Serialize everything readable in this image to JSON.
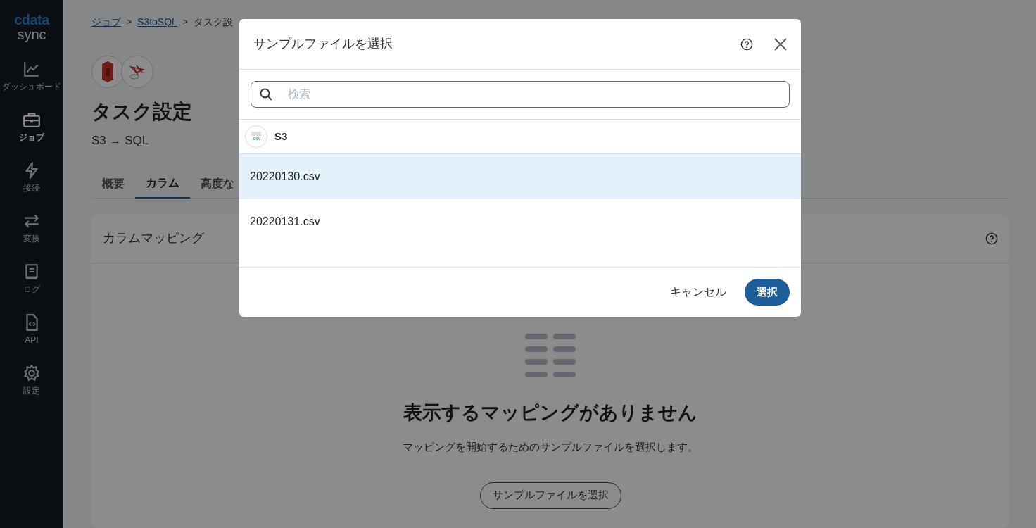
{
  "sidebar": {
    "logo": {
      "brand": "cdata",
      "product": "sync"
    },
    "items": [
      {
        "label": "ダッシュボード",
        "selected": false
      },
      {
        "label": "ジョブ",
        "selected": true
      },
      {
        "label": "接続",
        "selected": false
      },
      {
        "label": "変換",
        "selected": false
      },
      {
        "label": "ログ",
        "selected": false
      },
      {
        "label": "API",
        "selected": false
      },
      {
        "label": "設定",
        "selected": false
      }
    ]
  },
  "breadcrumb": [
    {
      "label": "ジョブ",
      "link": true
    },
    {
      "label": ">",
      "separator": true
    },
    {
      "label": "S3toSQL",
      "link": true
    },
    {
      "label": ">",
      "separator": true
    },
    {
      "label": "タスク設",
      "link": false
    }
  ],
  "page": {
    "title": "タスク設定",
    "subtitle": "S3 → SQL"
  },
  "tabs": [
    {
      "label": "概要",
      "selected": false
    },
    {
      "label": "カラム",
      "selected": true
    },
    {
      "label": "高度な",
      "selected": false
    }
  ],
  "card": {
    "title": "カラムマッピング",
    "empty_title": "表示するマッピングがありません",
    "empty_text": "マッピングを開始するためのサンプルファイルを選択します。",
    "button": "サンプルファイルを選択"
  },
  "dialog": {
    "title": "サンプルファイルを選択",
    "search": {
      "placeholder": "検索"
    },
    "group": {
      "label": "S3",
      "badge": ".csv"
    },
    "files": [
      {
        "name": "20220130.csv",
        "selected": true
      },
      {
        "name": "20220131.csv",
        "selected": false
      }
    ],
    "cancel": "キャンセル",
    "confirm": "選択"
  }
}
